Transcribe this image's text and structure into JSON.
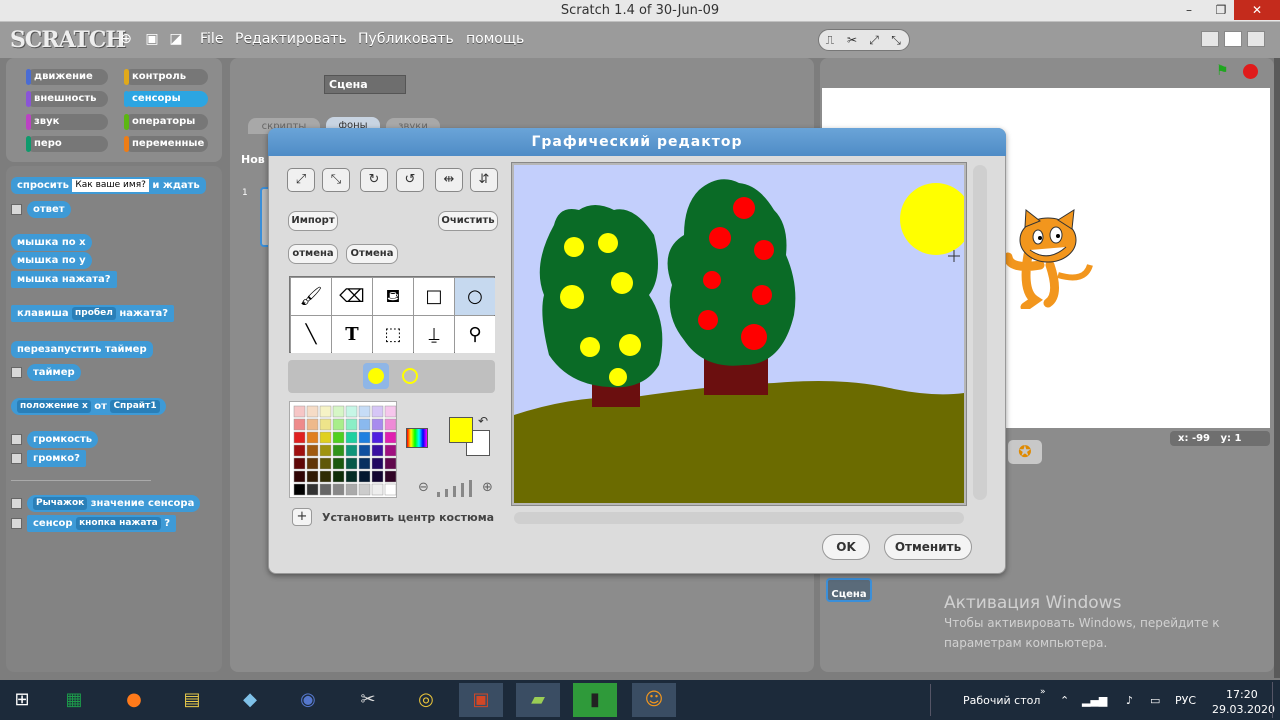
{
  "window": {
    "title": "Scratch 1.4 of 30-Jun-09",
    "minimize": "–",
    "maximize": "❐",
    "close": "✕"
  },
  "menu": {
    "logo": "SCRATCH",
    "file": "File",
    "edit": "Редактировать",
    "publish": "Публиковать",
    "help": "помощь"
  },
  "categories": [
    {
      "label": "движение",
      "color": "#4a6cd4"
    },
    {
      "label": "контроль",
      "color": "#e1a91a"
    },
    {
      "label": "внешность",
      "color": "#8a55d7"
    },
    {
      "label": "сенсоры",
      "color": "#2ca5e2"
    },
    {
      "label": "звук",
      "color": "#bb42c3"
    },
    {
      "label": "операторы",
      "color": "#5cb712"
    },
    {
      "label": "перо",
      "color": "#0e9a6c"
    },
    {
      "label": "переменные",
      "color": "#ee7d16"
    }
  ],
  "blocks": {
    "ask_a": "спросить",
    "ask_input": "Как ваше имя?",
    "ask_b": "и ждать",
    "answer": "ответ",
    "mouse_x": "мышка по x",
    "mouse_y": "мышка по y",
    "mouse_down": "мышка нажата?",
    "key_a": "клавиша",
    "key_dd": "пробел",
    "key_b": "нажата?",
    "reset_timer": "перезапустить таймер",
    "timer": "таймер",
    "pos_dd": "положение x",
    "pos_of": "от",
    "pos_sprite": "Спрайт1",
    "loudness": "громкость",
    "loud": "громко?",
    "sensor_dd": "Рычажок",
    "sensor_value": "значение сенсора",
    "sensor_a": "сенсор",
    "sensor_dd2": "кнопка нажата",
    "sensor_q": "?"
  },
  "middle": {
    "name_field": "Сцена",
    "tab_scripts": "скрипты",
    "tab_backgrounds": "фоны",
    "tab_sounds": "звуки",
    "new_label": "Нов",
    "item_num": "1"
  },
  "dialog": {
    "title": "Графический редактор",
    "import": "Импорт",
    "clear": "Очистить",
    "undo": "отмена",
    "redo": "Отмена",
    "set_center": "Установить центр костюма",
    "ok": "OK",
    "cancel": "Отменить",
    "primary_color": "#ffff00",
    "secondary_color": "#ffffff"
  },
  "stage": {
    "x_label": "x:",
    "x_value": "-99",
    "y_label": "y:",
    "y_value": "1",
    "scene_label": "Сцена"
  },
  "activation": {
    "title": "Активация Windows",
    "line1": "Чтобы активировать Windows, перейдите к",
    "line2": "параметрам компьютера."
  },
  "taskbar": {
    "desktop": "Рабочий стол",
    "lang": "РУС",
    "time": "17:20",
    "date": "29.03.2020"
  }
}
